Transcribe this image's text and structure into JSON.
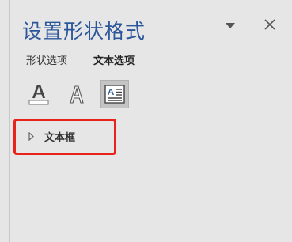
{
  "pane": {
    "title": "设置形状格式"
  },
  "tabs": [
    {
      "label": "形状选项",
      "active": false
    },
    {
      "label": "文本选项",
      "active": true
    }
  ],
  "icons": {
    "text_fill": "text-fill-outline-icon",
    "text_effects": "text-effects-icon",
    "textbox": "textbox-layout-icon"
  },
  "section": {
    "label": "文本框",
    "expanded": false
  },
  "colors": {
    "title": "#2b579a",
    "highlight": "#e8231c",
    "background": "#e6e6e6"
  }
}
